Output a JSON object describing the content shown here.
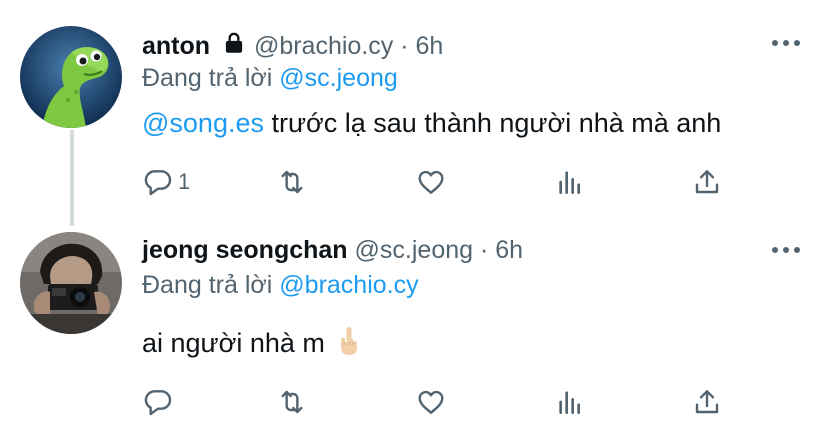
{
  "tweets": [
    {
      "name": "anton",
      "handle": "@brachio.cy",
      "separator": "·",
      "time": "6h",
      "replying_prefix": "Đang trả lời",
      "replying_to": "@sc.jeong",
      "mention": "@song.es",
      "text": " trước lạ sau thành người nhà mà anh",
      "reply_count": "1",
      "protected": true
    },
    {
      "name": "jeong seongchan",
      "handle": "@sc.jeong",
      "separator": "·",
      "time": "6h",
      "replying_prefix": "Đang trả lời",
      "replying_to": "@brachio.cy",
      "text": "ai người nhà m",
      "emoji": "middle-finger-emoji"
    }
  ],
  "icons": {
    "more": "more-dots-icon",
    "reply": "reply-icon",
    "retweet": "retweet-icon",
    "like": "like-icon",
    "views": "analytics-icon",
    "share": "share-icon",
    "lock": "lock-icon"
  },
  "colors": {
    "link": "#1d9bf0",
    "secondary_text": "#536471",
    "primary_text": "#0f1419"
  }
}
